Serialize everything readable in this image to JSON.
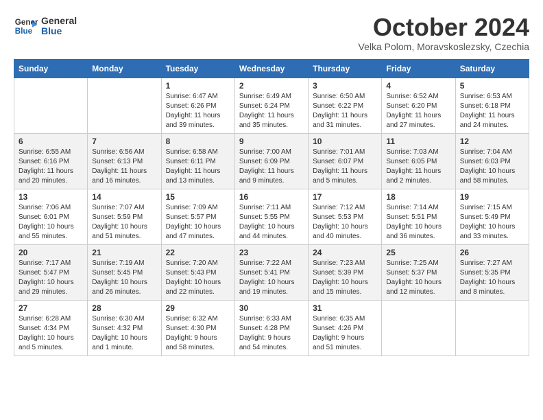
{
  "logo": {
    "line1": "General",
    "line2": "Blue"
  },
  "title": "October 2024",
  "subtitle": "Velka Polom, Moravskoslezsky, Czechia",
  "weekdays": [
    "Sunday",
    "Monday",
    "Tuesday",
    "Wednesday",
    "Thursday",
    "Friday",
    "Saturday"
  ],
  "weeks": [
    [
      {
        "day": "",
        "sunrise": "",
        "sunset": "",
        "daylight": ""
      },
      {
        "day": "",
        "sunrise": "",
        "sunset": "",
        "daylight": ""
      },
      {
        "day": "1",
        "sunrise": "Sunrise: 6:47 AM",
        "sunset": "Sunset: 6:26 PM",
        "daylight": "Daylight: 11 hours and 39 minutes."
      },
      {
        "day": "2",
        "sunrise": "Sunrise: 6:49 AM",
        "sunset": "Sunset: 6:24 PM",
        "daylight": "Daylight: 11 hours and 35 minutes."
      },
      {
        "day": "3",
        "sunrise": "Sunrise: 6:50 AM",
        "sunset": "Sunset: 6:22 PM",
        "daylight": "Daylight: 11 hours and 31 minutes."
      },
      {
        "day": "4",
        "sunrise": "Sunrise: 6:52 AM",
        "sunset": "Sunset: 6:20 PM",
        "daylight": "Daylight: 11 hours and 27 minutes."
      },
      {
        "day": "5",
        "sunrise": "Sunrise: 6:53 AM",
        "sunset": "Sunset: 6:18 PM",
        "daylight": "Daylight: 11 hours and 24 minutes."
      }
    ],
    [
      {
        "day": "6",
        "sunrise": "Sunrise: 6:55 AM",
        "sunset": "Sunset: 6:16 PM",
        "daylight": "Daylight: 11 hours and 20 minutes."
      },
      {
        "day": "7",
        "sunrise": "Sunrise: 6:56 AM",
        "sunset": "Sunset: 6:13 PM",
        "daylight": "Daylight: 11 hours and 16 minutes."
      },
      {
        "day": "8",
        "sunrise": "Sunrise: 6:58 AM",
        "sunset": "Sunset: 6:11 PM",
        "daylight": "Daylight: 11 hours and 13 minutes."
      },
      {
        "day": "9",
        "sunrise": "Sunrise: 7:00 AM",
        "sunset": "Sunset: 6:09 PM",
        "daylight": "Daylight: 11 hours and 9 minutes."
      },
      {
        "day": "10",
        "sunrise": "Sunrise: 7:01 AM",
        "sunset": "Sunset: 6:07 PM",
        "daylight": "Daylight: 11 hours and 5 minutes."
      },
      {
        "day": "11",
        "sunrise": "Sunrise: 7:03 AM",
        "sunset": "Sunset: 6:05 PM",
        "daylight": "Daylight: 11 hours and 2 minutes."
      },
      {
        "day": "12",
        "sunrise": "Sunrise: 7:04 AM",
        "sunset": "Sunset: 6:03 PM",
        "daylight": "Daylight: 10 hours and 58 minutes."
      }
    ],
    [
      {
        "day": "13",
        "sunrise": "Sunrise: 7:06 AM",
        "sunset": "Sunset: 6:01 PM",
        "daylight": "Daylight: 10 hours and 55 minutes."
      },
      {
        "day": "14",
        "sunrise": "Sunrise: 7:07 AM",
        "sunset": "Sunset: 5:59 PM",
        "daylight": "Daylight: 10 hours and 51 minutes."
      },
      {
        "day": "15",
        "sunrise": "Sunrise: 7:09 AM",
        "sunset": "Sunset: 5:57 PM",
        "daylight": "Daylight: 10 hours and 47 minutes."
      },
      {
        "day": "16",
        "sunrise": "Sunrise: 7:11 AM",
        "sunset": "Sunset: 5:55 PM",
        "daylight": "Daylight: 10 hours and 44 minutes."
      },
      {
        "day": "17",
        "sunrise": "Sunrise: 7:12 AM",
        "sunset": "Sunset: 5:53 PM",
        "daylight": "Daylight: 10 hours and 40 minutes."
      },
      {
        "day": "18",
        "sunrise": "Sunrise: 7:14 AM",
        "sunset": "Sunset: 5:51 PM",
        "daylight": "Daylight: 10 hours and 36 minutes."
      },
      {
        "day": "19",
        "sunrise": "Sunrise: 7:15 AM",
        "sunset": "Sunset: 5:49 PM",
        "daylight": "Daylight: 10 hours and 33 minutes."
      }
    ],
    [
      {
        "day": "20",
        "sunrise": "Sunrise: 7:17 AM",
        "sunset": "Sunset: 5:47 PM",
        "daylight": "Daylight: 10 hours and 29 minutes."
      },
      {
        "day": "21",
        "sunrise": "Sunrise: 7:19 AM",
        "sunset": "Sunset: 5:45 PM",
        "daylight": "Daylight: 10 hours and 26 minutes."
      },
      {
        "day": "22",
        "sunrise": "Sunrise: 7:20 AM",
        "sunset": "Sunset: 5:43 PM",
        "daylight": "Daylight: 10 hours and 22 minutes."
      },
      {
        "day": "23",
        "sunrise": "Sunrise: 7:22 AM",
        "sunset": "Sunset: 5:41 PM",
        "daylight": "Daylight: 10 hours and 19 minutes."
      },
      {
        "day": "24",
        "sunrise": "Sunrise: 7:23 AM",
        "sunset": "Sunset: 5:39 PM",
        "daylight": "Daylight: 10 hours and 15 minutes."
      },
      {
        "day": "25",
        "sunrise": "Sunrise: 7:25 AM",
        "sunset": "Sunset: 5:37 PM",
        "daylight": "Daylight: 10 hours and 12 minutes."
      },
      {
        "day": "26",
        "sunrise": "Sunrise: 7:27 AM",
        "sunset": "Sunset: 5:35 PM",
        "daylight": "Daylight: 10 hours and 8 minutes."
      }
    ],
    [
      {
        "day": "27",
        "sunrise": "Sunrise: 6:28 AM",
        "sunset": "Sunset: 4:34 PM",
        "daylight": "Daylight: 10 hours and 5 minutes."
      },
      {
        "day": "28",
        "sunrise": "Sunrise: 6:30 AM",
        "sunset": "Sunset: 4:32 PM",
        "daylight": "Daylight: 10 hours and 1 minute."
      },
      {
        "day": "29",
        "sunrise": "Sunrise: 6:32 AM",
        "sunset": "Sunset: 4:30 PM",
        "daylight": "Daylight: 9 hours and 58 minutes."
      },
      {
        "day": "30",
        "sunrise": "Sunrise: 6:33 AM",
        "sunset": "Sunset: 4:28 PM",
        "daylight": "Daylight: 9 hours and 54 minutes."
      },
      {
        "day": "31",
        "sunrise": "Sunrise: 6:35 AM",
        "sunset": "Sunset: 4:26 PM",
        "daylight": "Daylight: 9 hours and 51 minutes."
      },
      {
        "day": "",
        "sunrise": "",
        "sunset": "",
        "daylight": ""
      },
      {
        "day": "",
        "sunrise": "",
        "sunset": "",
        "daylight": ""
      }
    ]
  ]
}
